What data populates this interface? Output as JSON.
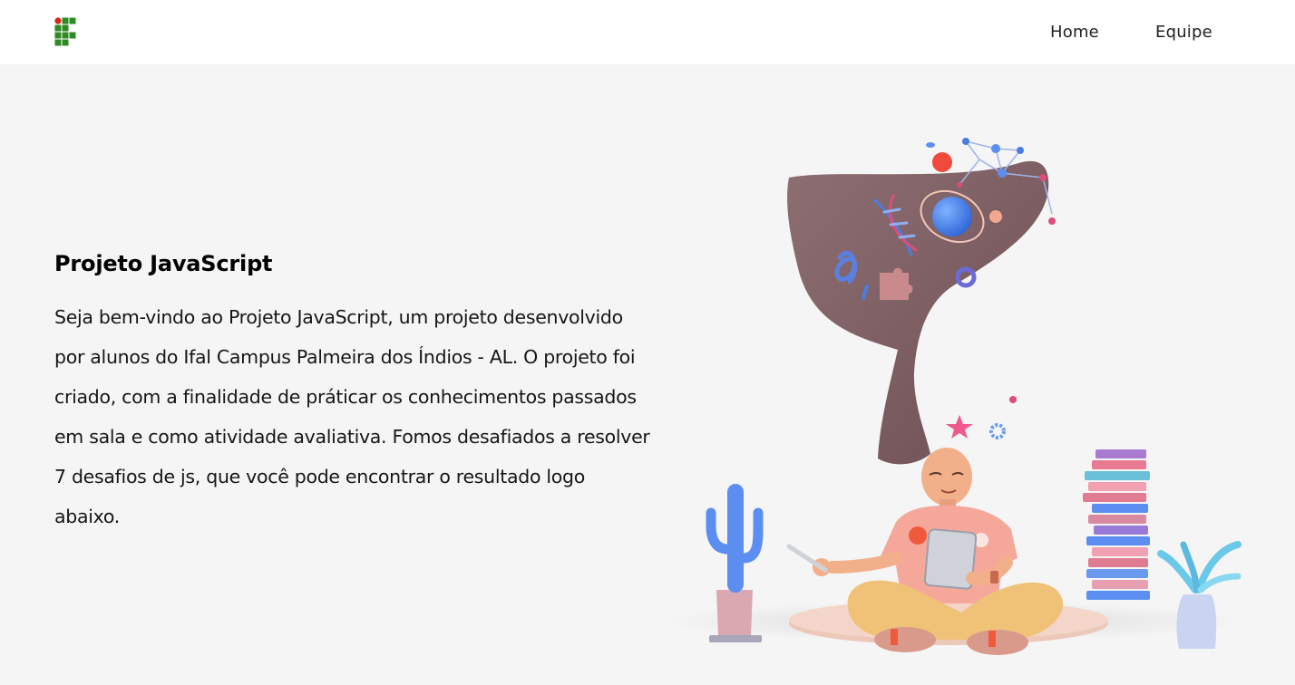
{
  "header": {
    "logo_name": "ifal-logo",
    "nav": {
      "home": "Home",
      "team": "Equipe"
    }
  },
  "hero": {
    "title": "Projeto JavaScript",
    "paragraph": "Seja bem-vindo ao Projeto JavaScript, um projeto desenvolvido por alunos do Ifal Campus Palmeira dos Índios - AL. O projeto foi criado, com a finalidade de práticar os conhecimentos passados em sala e como atividade avaliativa. Fomos desafiados a resolver 7 desafios de js, que você pode encontrar o resultado logo abaixo."
  },
  "colors": {
    "logo_green": "#2e8b24",
    "logo_red": "#d62718",
    "background": "#f5f5f5",
    "header_bg": "#ffffff"
  }
}
